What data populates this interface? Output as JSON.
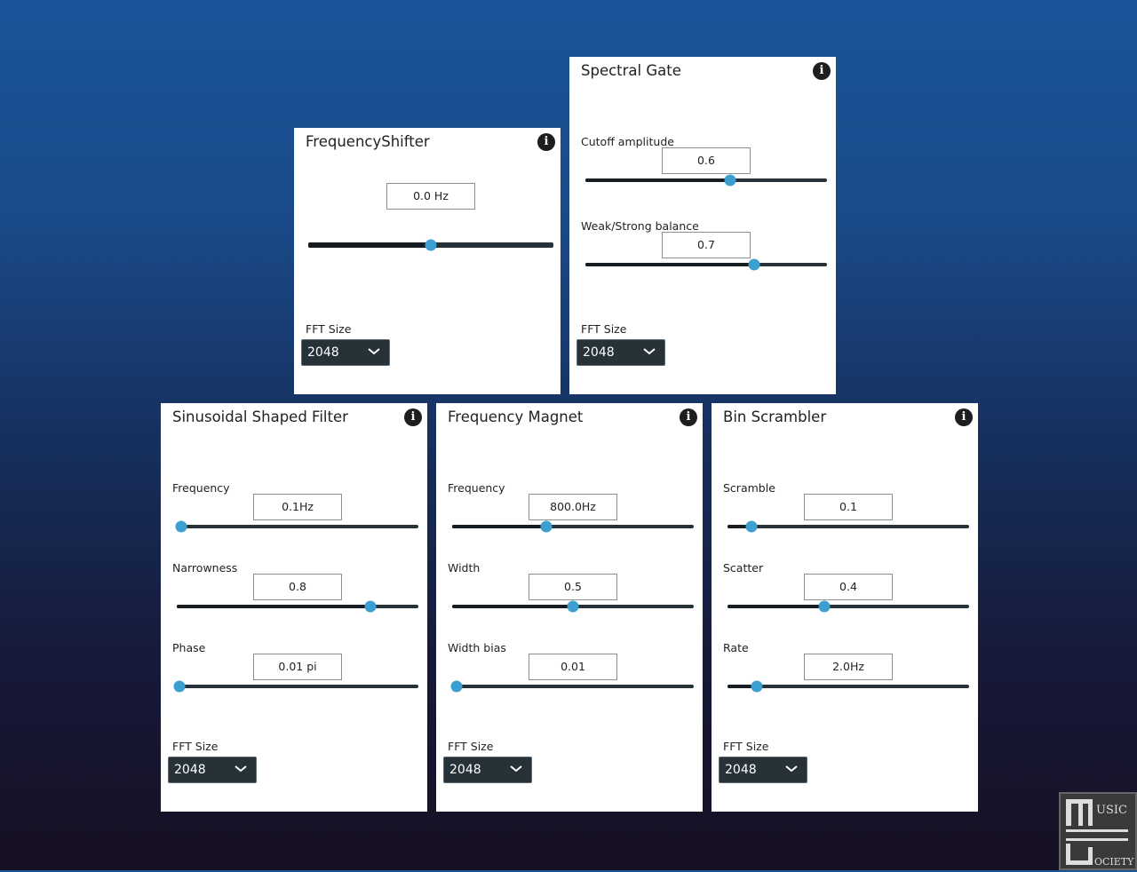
{
  "panels": [
    {
      "id": "frequency-shifter",
      "title": "FrequencyShifter",
      "params": [
        {
          "label": "",
          "value": "0.0 Hz",
          "position": 0.5
        }
      ],
      "fft_label": "FFT Size",
      "fft_value": "2048"
    },
    {
      "id": "spectral-gate",
      "title": "Spectral Gate",
      "params": [
        {
          "label": "Cutoff amplitude",
          "value": "0.6",
          "position": 0.6
        },
        {
          "label": "Weak/Strong balance",
          "value": "0.7",
          "position": 0.7
        }
      ],
      "fft_label": "FFT Size",
      "fft_value": "2048"
    },
    {
      "id": "sinusoidal-shaped-filter",
      "title": "Sinusoidal Shaped Filter",
      "params": [
        {
          "label": "Frequency",
          "value": "0.1Hz",
          "position": 0.02
        },
        {
          "label": "Narrowness",
          "value": "0.8",
          "position": 0.8
        },
        {
          "label": "Phase",
          "value": "0.01 pi",
          "position": 0.01
        }
      ],
      "fft_label": "FFT Size",
      "fft_value": "2048"
    },
    {
      "id": "frequency-magnet",
      "title": "Frequency Magnet",
      "params": [
        {
          "label": "Frequency",
          "value": "800.0Hz",
          "position": 0.39
        },
        {
          "label": "Width",
          "value": "0.5",
          "position": 0.5
        },
        {
          "label": "Width bias",
          "value": "0.01",
          "position": 0.02
        }
      ],
      "fft_label": "FFT Size",
      "fft_value": "2048"
    },
    {
      "id": "bin-scrambler",
      "title": "Bin Scrambler",
      "params": [
        {
          "label": "Scramble",
          "value": "0.1",
          "position": 0.1
        },
        {
          "label": "Scatter",
          "value": "0.4",
          "position": 0.4
        },
        {
          "label": "Rate",
          "value": "2.0Hz",
          "position": 0.12
        }
      ],
      "fft_label": "FFT Size",
      "fft_value": "2048"
    }
  ],
  "logo": {
    "text": "MUSIC SOCIETY"
  },
  "colors": {
    "thumb": "#3d9fcf",
    "track": "#263238",
    "select_bg": "#263238"
  }
}
